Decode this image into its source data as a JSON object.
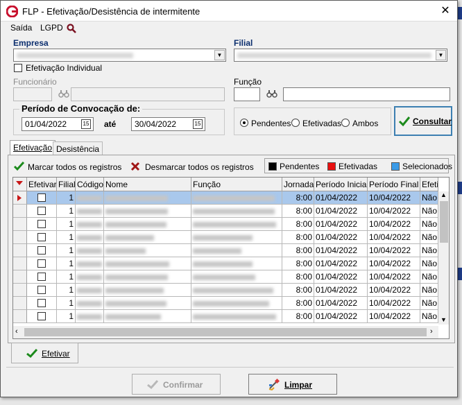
{
  "window": {
    "title": "FLP - Efetivação/Desistência de intermitente",
    "close": "✕"
  },
  "menu": {
    "items": [
      "Saída",
      "LGPD"
    ]
  },
  "form": {
    "empresa_label": "Empresa",
    "filial_label": "Filial",
    "efetivacao_individual": "Efetivação Individual",
    "funcionario_label": "Funcionário",
    "funcao_label": "Função",
    "periodo_label": "Período de Convocação de:",
    "date_from": "01/04/2022",
    "ate": "até",
    "date_to": "30/04/2022",
    "cal_icon": "15",
    "radios": [
      "Pendentes",
      "Efetivadas",
      "Ambos"
    ],
    "radio_selected": "Pendentes",
    "consultar": "Consultar"
  },
  "tabs": [
    "Efetivação",
    "Desistência"
  ],
  "toolbar": {
    "mark_all": "Marcar todos os registros",
    "unmark_all": "Desmarcar todos os registros"
  },
  "legend": [
    {
      "label": "Pendentes",
      "color": "#000000"
    },
    {
      "label": "Efetivadas",
      "color": "#e81010"
    },
    {
      "label": "Selecionados",
      "color": "#3a9be8"
    }
  ],
  "grid": {
    "columns": [
      "Efetivar",
      "Filial",
      "Código",
      "Nome",
      "Função",
      "Jornada",
      "Período Inicial",
      "Período Final",
      "Efeti"
    ],
    "rows": [
      {
        "filial": "1",
        "jornada": "8:00",
        "inicio": "01/04/2022",
        "fim": "10/04/2022",
        "efet": "Não"
      },
      {
        "filial": "1",
        "jornada": "8:00",
        "inicio": "01/04/2022",
        "fim": "10/04/2022",
        "efet": "Não"
      },
      {
        "filial": "1",
        "jornada": "8:00",
        "inicio": "01/04/2022",
        "fim": "10/04/2022",
        "efet": "Não"
      },
      {
        "filial": "1",
        "jornada": "8:00",
        "inicio": "01/04/2022",
        "fim": "10/04/2022",
        "efet": "Não"
      },
      {
        "filial": "1",
        "jornada": "8:00",
        "inicio": "01/04/2022",
        "fim": "10/04/2022",
        "efet": "Não"
      },
      {
        "filial": "1",
        "jornada": "8:00",
        "inicio": "01/04/2022",
        "fim": "10/04/2022",
        "efet": "Não"
      },
      {
        "filial": "1",
        "jornada": "8:00",
        "inicio": "01/04/2022",
        "fim": "10/04/2022",
        "efet": "Não"
      },
      {
        "filial": "1",
        "jornada": "8:00",
        "inicio": "01/04/2022",
        "fim": "10/04/2022",
        "efet": "Não"
      },
      {
        "filial": "1",
        "jornada": "8:00",
        "inicio": "01/04/2022",
        "fim": "10/04/2022",
        "efet": "Não"
      },
      {
        "filial": "1",
        "jornada": "8:00",
        "inicio": "01/04/2022",
        "fim": "10/04/2022",
        "efet": "Não"
      }
    ]
  },
  "buttons": {
    "efetivar": "Efetivar",
    "confirmar": "Confirmar",
    "limpar": "Limpar"
  },
  "colors": {
    "accent": "#3c7fb1",
    "selected_row": "#a9c8ec",
    "check_green": "#1c8a1c",
    "title_red": "#c8102e"
  }
}
